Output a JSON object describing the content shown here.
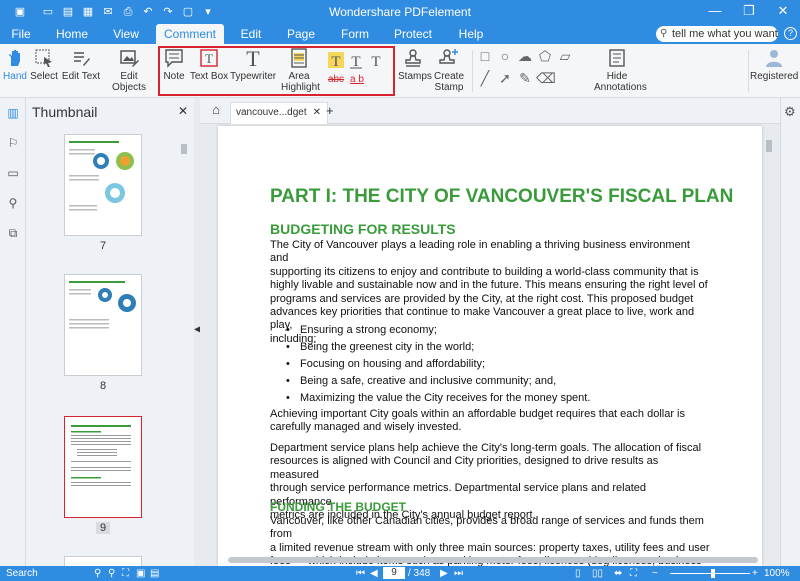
{
  "app": {
    "title": "Wondershare PDFelement"
  },
  "menu": {
    "tabs": [
      {
        "label": "File"
      },
      {
        "label": "Home"
      },
      {
        "label": "View"
      },
      {
        "label": "Comment"
      },
      {
        "label": "Edit"
      },
      {
        "label": "Page"
      },
      {
        "label": "Form"
      },
      {
        "label": "Protect"
      },
      {
        "label": "Help"
      }
    ],
    "search_placeholder": "tell me what you want to"
  },
  "ribbon": {
    "hand": "Hand",
    "select": "Select",
    "edit_text": "Edit Text",
    "edit_objects": "Edit Objects",
    "note": "Note",
    "text_box": "Text Box",
    "typewriter": "Typewriter",
    "area_highlight_1": "Area",
    "area_highlight_2": "Highlight",
    "strike_label": "abc",
    "underline_label": "a b",
    "stamps": "Stamps",
    "create_stamp_1": "Create",
    "create_stamp_2": "Stamp",
    "hide_annotations_1": "Hide",
    "hide_annotations_2": "Annotations",
    "registered": "Registered"
  },
  "thumbnails": {
    "title": "Thumbnail",
    "pages": [
      {
        "label": "7"
      },
      {
        "label": "8"
      },
      {
        "label": "9"
      }
    ]
  },
  "tabs": {
    "doc_tab": "vancouve...dget"
  },
  "document": {
    "heading": "PART I: THE CITY OF VANCOUVER'S FISCAL PLAN",
    "sub1": "BUDGETING FOR RESULTS",
    "lines1": [
      "The City of Vancouver plays a leading role in enabling a thriving business environment and",
      "supporting its citizens to enjoy and contribute to building a world-class community that is",
      "highly livable and sustainable now and in the future. This means ensuring the right level of",
      "programs and services are provided by the City, at the right cost. This proposed budget",
      "advances key priorities that continue to make Vancouver a great place to live, work and play,",
      "including:"
    ],
    "bullets": [
      "Ensuring a strong economy;",
      "Being the greenest city in the world;",
      "Focusing on housing and affordability;",
      "Being a safe, creative and inclusive community; and,",
      "Maximizing the value the City receives for the money spent."
    ],
    "lines2": [
      "Achieving important City goals within an affordable budget requires that each dollar is",
      "carefully managed and wisely invested."
    ],
    "lines3": [
      "Department service plans help achieve the City's long-term goals. The allocation of fiscal",
      "resources is aligned with Council and City priorities, designed to drive results as measured",
      "through service performance metrics. Departmental service plans and related performance",
      "metrics are included in the City's annual budget report."
    ],
    "sub2": "FUNDING THE BUDGET",
    "lines4": [
      "Vancouver, like other Canadian cities, provides a broad range of services and funds them from",
      "a limited revenue stream with only three main sources: property taxes, utility fees and user",
      "fees — which include items such as parking meter fees, licences (dog licences, business"
    ]
  },
  "status": {
    "search": "Search",
    "page_current": "9",
    "page_total": "/ 348",
    "zoom": "100%"
  },
  "colors": {
    "accent": "#2f8ce0",
    "heading": "#3a9b3a",
    "highlight_box": "#d9232e"
  }
}
